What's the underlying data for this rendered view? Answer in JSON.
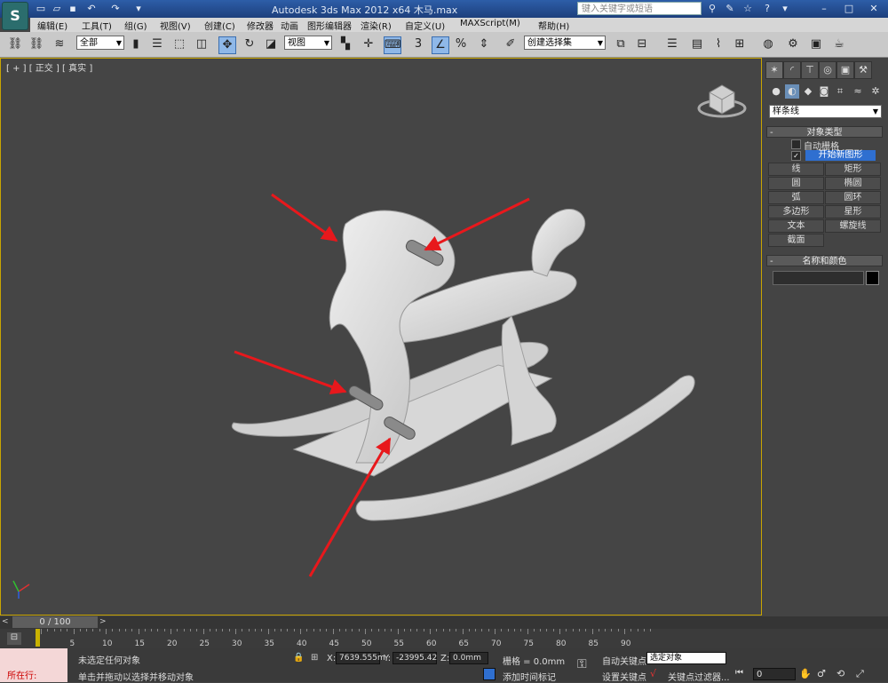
{
  "titlebar": {
    "title": "Autodesk 3ds Max  2012 x64      木马.max",
    "search_placeholder": "键入关键字或短语"
  },
  "menu": [
    "编辑(E)",
    "工具(T)",
    "组(G)",
    "视图(V)",
    "创建(C)",
    "修改器",
    "动画",
    "图形编辑器",
    "渲染(R)",
    "自定义(U)",
    "MAXScript(M)",
    "帮助(H)"
  ],
  "toolbar": {
    "selection_filter": "全部",
    "ref_coord": "视图",
    "named_selection": "创建选择集",
    "snap_label": "3"
  },
  "viewport": {
    "label": "[ + ] [ 正交 ] [ 真实 ]",
    "colors": {
      "arrow": "#e8181c",
      "model": "#dcdcdc",
      "border": "#c9a500"
    }
  },
  "command_panel": {
    "category": "样条线",
    "object_type_title": "对象类型",
    "auto_grid": "自动栅格",
    "start_new_shape": "开始新图形",
    "buttons": [
      "线",
      "矩形",
      "圆",
      "椭圆",
      "弧",
      "圆环",
      "多边形",
      "星形",
      "文本",
      "螺旋线",
      "截面"
    ],
    "name_color_title": "名称和颜色"
  },
  "timeline": {
    "frame_label": "0 / 100",
    "ticks": [
      "0",
      "5",
      "10",
      "15",
      "20",
      "25",
      "30",
      "35",
      "40",
      "45",
      "50",
      "55",
      "60",
      "65",
      "70",
      "75",
      "80",
      "85",
      "90"
    ]
  },
  "status": {
    "script_label": "所在行:",
    "selection": "未选定任何对象",
    "prompt": "单击并拖动以选择并移动对象",
    "x_label": "X:",
    "x_value": "7639.555m",
    "y_label": "Y:",
    "y_value": "-23995.42",
    "z_label": "Z:",
    "z_value": "0.0mm",
    "grid": "栅格 = 0.0mm",
    "auto_key": "自动关键点",
    "set_key": "设置关键点",
    "selected": "选定对象",
    "key_filter": "关键点过滤器...",
    "add_time_tag": "添加时间标记",
    "frame_value": "0"
  }
}
